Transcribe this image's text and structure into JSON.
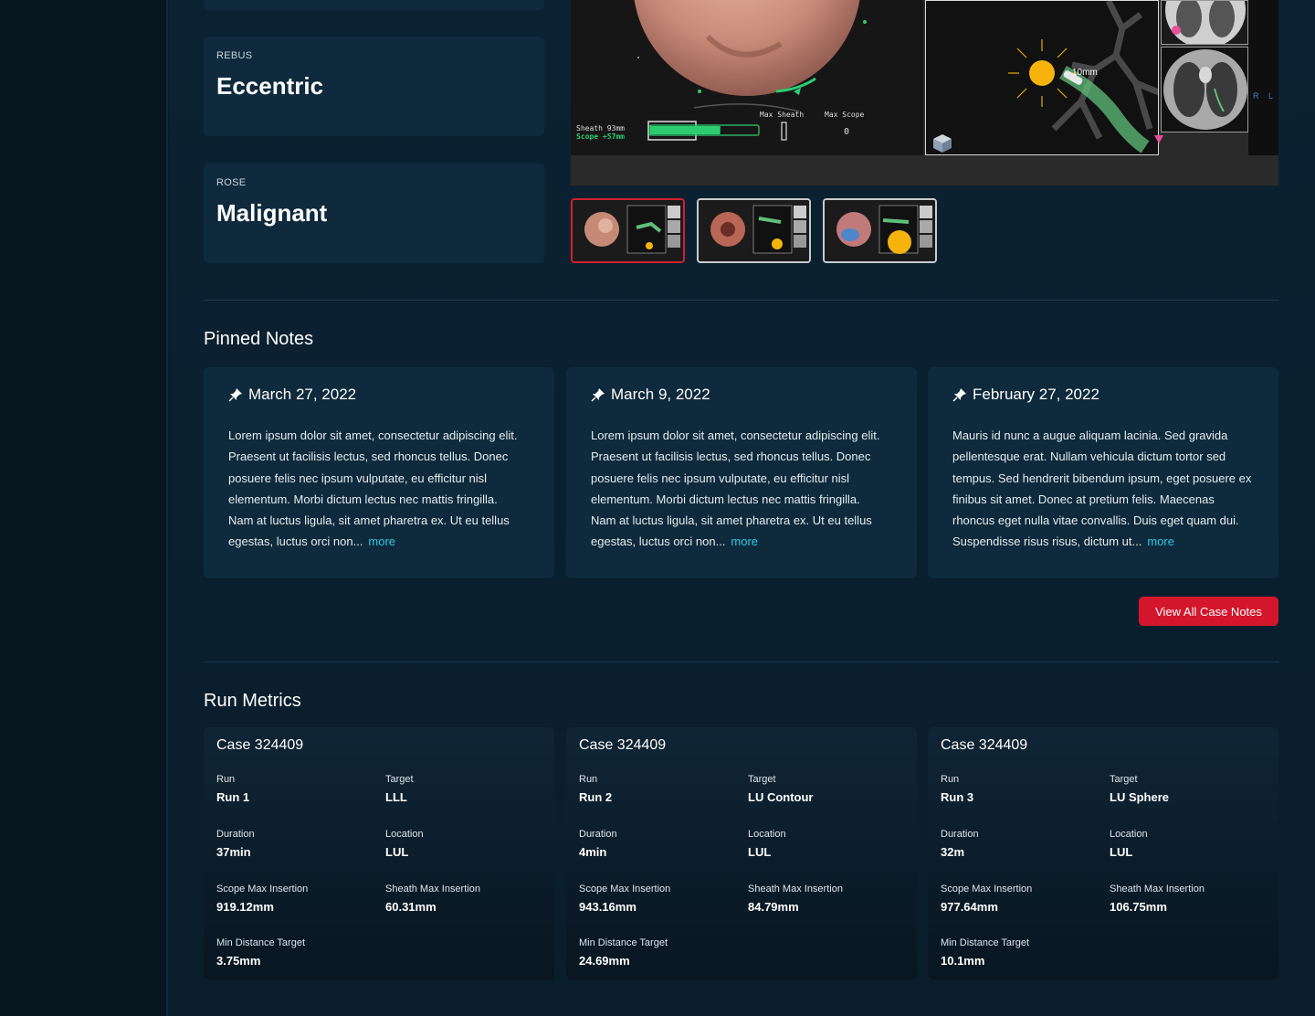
{
  "stats": [
    {
      "label": "REBUS",
      "value": "Eccentric"
    },
    {
      "label": "ROSE",
      "value": "Malignant"
    }
  ],
  "viewer": {
    "sheath_text": "Sheath 93mm",
    "scope_text": "Scope +57mm",
    "max_sheath_label": "Max Sheath",
    "max_scope_label": "Max Scope",
    "max_scope_value": "0",
    "distance_label": "10mm",
    "ct_label_r": "R",
    "ct_label_l": "L",
    "scope_progress": 0.65
  },
  "thumbnails": [
    {
      "name": "capture-1",
      "active": true
    },
    {
      "name": "capture-2",
      "active": false
    },
    {
      "name": "capture-3",
      "active": false
    }
  ],
  "pinned_notes": {
    "title": "Pinned Notes",
    "notes": [
      {
        "date": "March 27, 2022",
        "lines": [
          "Lorem ipsum dolor sit amet, consectetur adipiscing elit.",
          "Praesent ut facilisis lectus, sed rhoncus tellus. Donec",
          "posuere felis nec ipsum vulputate, eu efficitur nisl",
          "elementum. Morbi dictum lectus nec mattis fringilla.",
          "Nam at luctus ligula, sit amet pharetra ex. Ut eu tellus",
          "egestas, luctus orci non..."
        ],
        "more": "more"
      },
      {
        "date": "March 9, 2022",
        "lines": [
          "Lorem ipsum dolor sit amet, consectetur adipiscing elit.",
          "Praesent ut facilisis lectus, sed rhoncus tellus. Donec",
          "posuere felis nec ipsum vulputate, eu efficitur nisl",
          "elementum. Morbi dictum lectus nec mattis fringilla.",
          "Nam at luctus ligula, sit amet pharetra ex. Ut eu tellus",
          "egestas, luctus orci non..."
        ],
        "more": "more"
      },
      {
        "date": "February 27, 2022",
        "lines": [
          "Mauris id nunc a augue aliquam lacinia. Sed gravida",
          "pellentesque erat. Nullam vehicula dictum tortor sed",
          "tempus. Sed hendrerit bibendum ipsum, eget posuere ex",
          "finibus sit amet. Donec at pretium felis. Maecenas",
          "rhoncus eget nulla vitae convallis. Duis eget quam dui.",
          "Suspendisse risus risus, dictum ut..."
        ],
        "more": "more"
      }
    ],
    "view_all_label": "View All Case Notes"
  },
  "run_metrics": {
    "title": "Run Metrics",
    "labels": {
      "run": "Run",
      "target": "Target",
      "duration": "Duration",
      "location": "Location",
      "scope_max": "Scope Max Insertion",
      "sheath_max": "Sheath Max Insertion",
      "min_distance": "Min Distance Target"
    },
    "cards": [
      {
        "case": "Case 324409",
        "run": "Run 1",
        "target": "LLL",
        "duration": "37min",
        "location": "LUL",
        "scope_max": "919.12mm",
        "sheath_max": "60.31mm",
        "min_distance": "3.75mm"
      },
      {
        "case": "Case 324409",
        "run": "Run 2",
        "target": "LU Contour",
        "duration": "4min",
        "location": "LUL",
        "scope_max": "943.16mm",
        "sheath_max": "84.79mm",
        "min_distance": "24.69mm"
      },
      {
        "case": "Case 324409",
        "run": "Run 3",
        "target": "LU Sphere",
        "duration": "32m",
        "location": "LUL",
        "scope_max": "977.64mm",
        "sheath_max": "106.75mm",
        "min_distance": "10.1mm"
      }
    ]
  },
  "colors": {
    "accent_red": "#d3162b",
    "link_cyan": "#2fc9e6",
    "card_bg": "#0e2a3c",
    "scope_green": "#2ecc71"
  }
}
